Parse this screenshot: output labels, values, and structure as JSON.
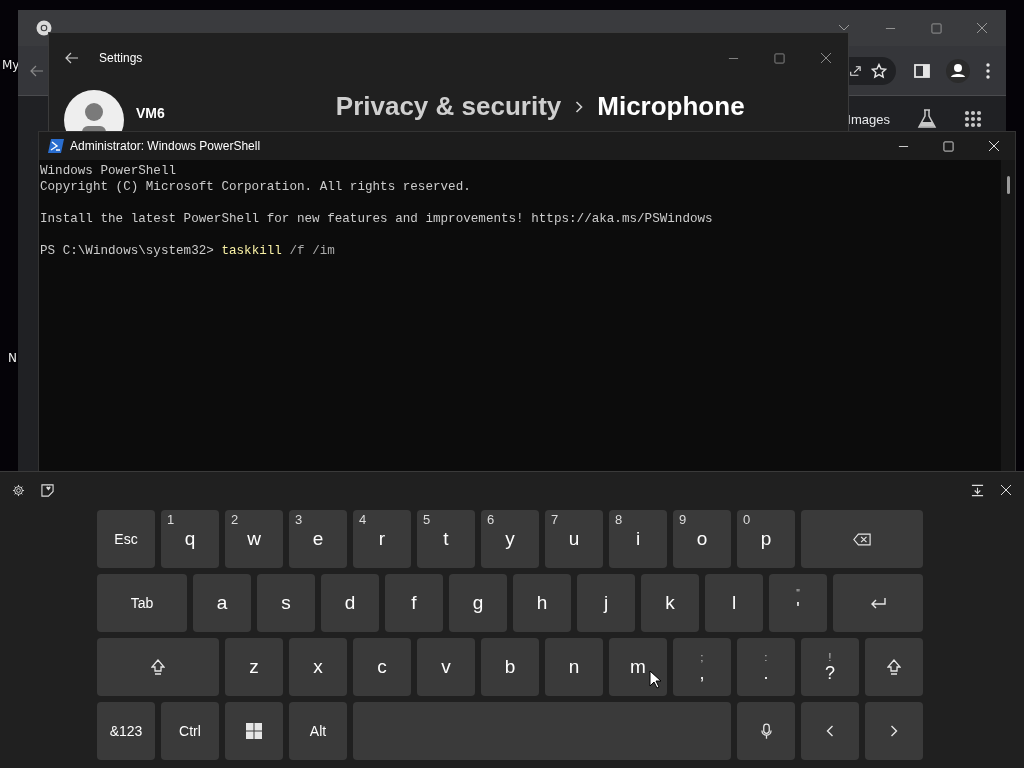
{
  "desktop": {
    "labels": [
      "My",
      "N"
    ]
  },
  "browser": {
    "content_links": [
      "Images"
    ]
  },
  "settings": {
    "title": "Settings",
    "account": {
      "name": "VM6"
    },
    "breadcrumb": [
      "Privacy & security",
      "Microphone"
    ]
  },
  "powershell": {
    "title": "Administrator: Windows PowerShell",
    "blocks": [
      [
        "Windows PowerShell",
        "Copyright (C) Microsoft Corporation. All rights reserved."
      ],
      [
        "Install the latest PowerShell for new features and improvements! https://aka.ms/PSWindows"
      ]
    ],
    "prompt": {
      "path": "PS C:\\Windows\\system32>",
      "command": "taskkill",
      "arguments": "/f /im"
    }
  },
  "keyboard": {
    "rows": [
      {
        "keys": [
          {
            "kind": "label",
            "label": "Esc"
          },
          {
            "kind": "letter",
            "label": "q",
            "hint": "1"
          },
          {
            "kind": "letter",
            "label": "w",
            "hint": "2"
          },
          {
            "kind": "letter",
            "label": "e",
            "hint": "3"
          },
          {
            "kind": "letter",
            "label": "r",
            "hint": "4"
          },
          {
            "kind": "letter",
            "label": "t",
            "hint": "5"
          },
          {
            "kind": "letter",
            "label": "y",
            "hint": "6"
          },
          {
            "kind": "letter",
            "label": "u",
            "hint": "7"
          },
          {
            "kind": "letter",
            "label": "i",
            "hint": "8"
          },
          {
            "kind": "letter",
            "label": "o",
            "hint": "9"
          },
          {
            "kind": "letter",
            "label": "p",
            "hint": "0"
          },
          {
            "kind": "backspace"
          }
        ]
      },
      {
        "keys": [
          {
            "kind": "tab",
            "label": "Tab"
          },
          {
            "kind": "letter",
            "label": "a"
          },
          {
            "kind": "letter",
            "label": "s"
          },
          {
            "kind": "letter",
            "label": "d"
          },
          {
            "kind": "letter",
            "label": "f"
          },
          {
            "kind": "letter",
            "label": "g"
          },
          {
            "kind": "letter",
            "label": "h"
          },
          {
            "kind": "letter",
            "label": "j"
          },
          {
            "kind": "letter",
            "label": "k"
          },
          {
            "kind": "letter",
            "label": "l"
          },
          {
            "kind": "punct",
            "label": "'",
            "hint": "\""
          },
          {
            "kind": "enter"
          }
        ]
      },
      {
        "keys": [
          {
            "kind": "shift"
          },
          {
            "kind": "letter",
            "label": "z"
          },
          {
            "kind": "letter",
            "label": "x"
          },
          {
            "kind": "letter",
            "label": "c"
          },
          {
            "kind": "letter",
            "label": "v"
          },
          {
            "kind": "letter",
            "label": "b"
          },
          {
            "kind": "letter",
            "label": "n"
          },
          {
            "kind": "letter",
            "label": "m"
          },
          {
            "kind": "punct",
            "label": ",",
            "hint": ";"
          },
          {
            "kind": "punct",
            "label": ".",
            "hint": ":"
          },
          {
            "kind": "punct",
            "label": "?",
            "hint": "!"
          },
          {
            "kind": "shift"
          }
        ]
      },
      {
        "keys": [
          {
            "kind": "label",
            "label": "&123"
          },
          {
            "kind": "label",
            "label": "Ctrl"
          },
          {
            "kind": "windows"
          },
          {
            "kind": "label",
            "label": "Alt"
          },
          {
            "kind": "space"
          },
          {
            "kind": "mic"
          },
          {
            "kind": "left"
          },
          {
            "kind": "right"
          }
        ]
      }
    ]
  }
}
